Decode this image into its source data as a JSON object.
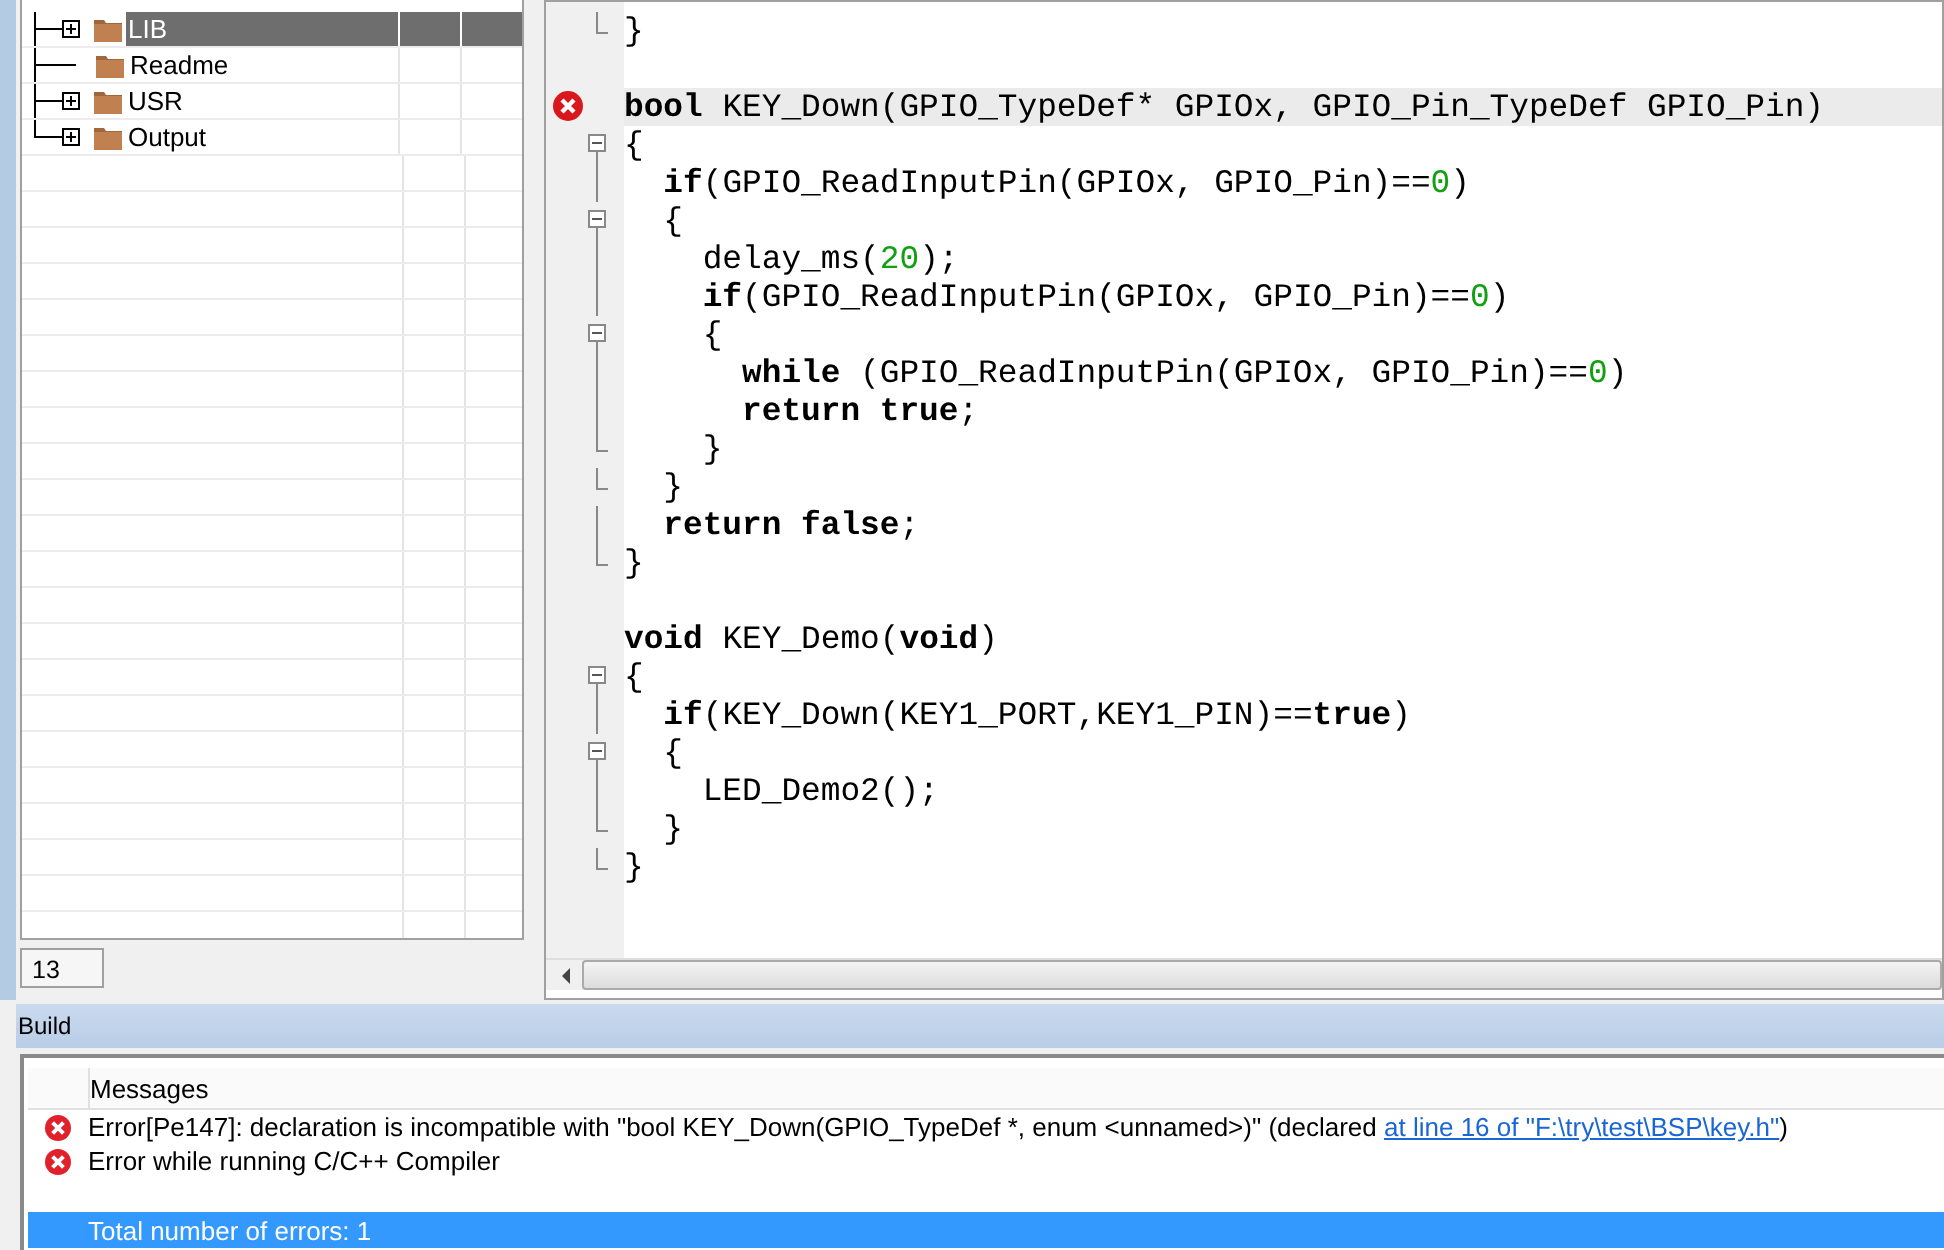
{
  "workspace": {
    "items": [
      {
        "label": "LIB",
        "expandable": true,
        "selected": true
      },
      {
        "label": "Readme",
        "expandable": false,
        "selected": false
      },
      {
        "label": "USR",
        "expandable": true,
        "selected": false
      },
      {
        "label": "Output",
        "expandable": true,
        "selected": false
      }
    ],
    "status_field": "13"
  },
  "editor": {
    "lines": [
      {
        "kind": "fold_end",
        "error": false,
        "current": false,
        "tokens": [
          {
            "kind": "plain",
            "text": "}"
          }
        ]
      },
      {
        "kind": "blank",
        "error": false,
        "current": false
      },
      {
        "kind": "plain",
        "error": true,
        "current": true,
        "tokens": [
          {
            "kind": "keyword",
            "text": "bool"
          },
          {
            "kind": "plain",
            "text": " KEY_Down(GPIO_TypeDef* GPIOx, GPIO_Pin_TypeDef GPIO_Pin)"
          }
        ]
      },
      {
        "kind": "fold_start",
        "error": false,
        "current": false,
        "tokens": [
          {
            "kind": "plain",
            "text": "{"
          }
        ]
      },
      {
        "kind": "fold_body",
        "error": false,
        "current": false,
        "tokens": [
          {
            "kind": "keyword",
            "text": "  if"
          },
          {
            "kind": "plain",
            "text": "(GPIO_ReadInputPin(GPIOx, GPIO_Pin)=="
          },
          {
            "kind": "number",
            "text": "0"
          },
          {
            "kind": "plain",
            "text": ")"
          }
        ]
      },
      {
        "kind": "fold_start",
        "error": false,
        "current": false,
        "tokens": [
          {
            "kind": "plain",
            "text": "  {"
          }
        ]
      },
      {
        "kind": "fold_body",
        "error": false,
        "current": false,
        "tokens": [
          {
            "kind": "plain",
            "text": "    delay_ms("
          },
          {
            "kind": "number",
            "text": "20"
          },
          {
            "kind": "plain",
            "text": ");"
          }
        ]
      },
      {
        "kind": "fold_body",
        "error": false,
        "current": false,
        "tokens": [
          {
            "kind": "keyword",
            "text": "    if"
          },
          {
            "kind": "plain",
            "text": "(GPIO_ReadInputPin(GPIOx, GPIO_Pin)=="
          },
          {
            "kind": "number",
            "text": "0"
          },
          {
            "kind": "plain",
            "text": ")"
          }
        ]
      },
      {
        "kind": "fold_start",
        "error": false,
        "current": false,
        "tokens": [
          {
            "kind": "plain",
            "text": "    {"
          }
        ]
      },
      {
        "kind": "fold_body",
        "error": false,
        "current": false,
        "tokens": [
          {
            "kind": "keyword",
            "text": "      while"
          },
          {
            "kind": "plain",
            "text": " (GPIO_ReadInputPin(GPIOx, GPIO_Pin)=="
          },
          {
            "kind": "number",
            "text": "0"
          },
          {
            "kind": "plain",
            "text": ")"
          }
        ]
      },
      {
        "kind": "fold_body",
        "error": false,
        "current": false,
        "tokens": [
          {
            "kind": "keyword",
            "text": "      return true"
          },
          {
            "kind": "plain",
            "text": ";"
          }
        ]
      },
      {
        "kind": "fold_end",
        "error": false,
        "current": false,
        "tokens": [
          {
            "kind": "plain",
            "text": "    }"
          }
        ]
      },
      {
        "kind": "fold_end",
        "error": false,
        "current": false,
        "tokens": [
          {
            "kind": "plain",
            "text": "  }"
          }
        ]
      },
      {
        "kind": "fold_body",
        "error": false,
        "current": false,
        "tokens": [
          {
            "kind": "keyword",
            "text": "  return false"
          },
          {
            "kind": "plain",
            "text": ";"
          }
        ]
      },
      {
        "kind": "fold_end",
        "error": false,
        "current": false,
        "tokens": [
          {
            "kind": "plain",
            "text": "}"
          }
        ]
      },
      {
        "kind": "blank",
        "error": false,
        "current": false
      },
      {
        "kind": "plain",
        "error": false,
        "current": false,
        "tokens": [
          {
            "kind": "keyword",
            "text": "void"
          },
          {
            "kind": "plain",
            "text": " KEY_Demo("
          },
          {
            "kind": "keyword",
            "text": "void"
          },
          {
            "kind": "plain",
            "text": ")"
          }
        ]
      },
      {
        "kind": "fold_start",
        "error": false,
        "current": false,
        "tokens": [
          {
            "kind": "plain",
            "text": "{"
          }
        ]
      },
      {
        "kind": "fold_body",
        "error": false,
        "current": false,
        "tokens": [
          {
            "kind": "keyword",
            "text": "  if"
          },
          {
            "kind": "plain",
            "text": "(KEY_Down(KEY1_PORT,KEY1_PIN)=="
          },
          {
            "kind": "keyword",
            "text": "true"
          },
          {
            "kind": "plain",
            "text": ")"
          }
        ]
      },
      {
        "kind": "fold_start",
        "error": false,
        "current": false,
        "tokens": [
          {
            "kind": "plain",
            "text": "  {"
          }
        ]
      },
      {
        "kind": "fold_body",
        "error": false,
        "current": false,
        "tokens": [
          {
            "kind": "plain",
            "text": "    LED_Demo2();"
          }
        ]
      },
      {
        "kind": "fold_end",
        "error": false,
        "current": false,
        "tokens": [
          {
            "kind": "plain",
            "text": "  }"
          }
        ]
      },
      {
        "kind": "fold_end",
        "error": false,
        "current": false,
        "tokens": [
          {
            "kind": "plain",
            "text": "}"
          }
        ]
      }
    ]
  },
  "build": {
    "title": "Build",
    "column": "Messages",
    "messages": [
      {
        "kind": "error",
        "selected": false,
        "text": "Error[Pe147]: declaration is incompatible with \"bool KEY_Down(GPIO_TypeDef *, enum <unnamed>)\" (declared ",
        "link": "at line 16 of \"F:\\try\\test\\BSP\\key.h\"",
        "after": ")"
      },
      {
        "kind": "error",
        "selected": false,
        "text": "Error while running C/C++ Compiler"
      },
      {
        "kind": "blank",
        "selected": false
      },
      {
        "kind": "info",
        "selected": true,
        "text": "Total number of errors: 1"
      }
    ]
  }
}
